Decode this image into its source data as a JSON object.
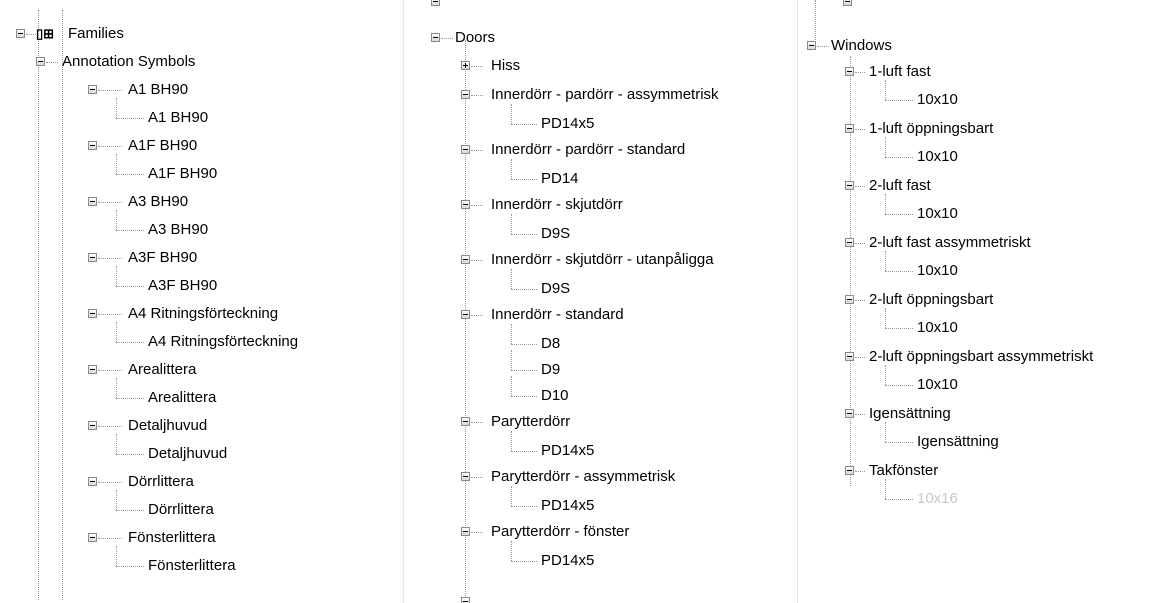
{
  "col1": {
    "root": "Families",
    "category": "Annotation Symbols",
    "items": [
      {
        "label": "A1 BH90",
        "child": "A1 BH90"
      },
      {
        "label": "A1F BH90",
        "child": "A1F BH90"
      },
      {
        "label": "A3 BH90",
        "child": "A3 BH90"
      },
      {
        "label": "A3F BH90",
        "child": "A3F BH90"
      },
      {
        "label": "A4 Ritningsförteckning",
        "child": "A4 Ritningsförteckning"
      },
      {
        "label": "Arealittera",
        "child": "Arealittera"
      },
      {
        "label": "Detaljhuvud",
        "child": "Detaljhuvud"
      },
      {
        "label": "Dörrlittera",
        "child": "Dörrlittera"
      },
      {
        "label": "Fönsterlittera",
        "child": "Fönsterlittera"
      }
    ]
  },
  "col2": {
    "category": "Doors",
    "items": [
      {
        "label": "Hiss",
        "children": []
      },
      {
        "label": "Innerdörr - pardörr - assymmetrisk",
        "children": [
          "PD14x5"
        ]
      },
      {
        "label": "Innerdörr - pardörr - standard",
        "children": [
          "PD14"
        ]
      },
      {
        "label": "Innerdörr - skjutdörr",
        "children": [
          "D9S"
        ]
      },
      {
        "label": "Innerdörr - skjutdörr - utanpåligga",
        "children": [
          "D9S"
        ]
      },
      {
        "label": "Innerdörr - standard",
        "children": [
          "D8",
          "D9",
          "D10"
        ]
      },
      {
        "label": "Parytterdörr",
        "children": [
          "PD14x5"
        ]
      },
      {
        "label": "Parytterdörr - assymmetrisk",
        "children": [
          "PD14x5"
        ]
      },
      {
        "label": "Parytterdörr - fönster",
        "children": [
          "PD14x5"
        ]
      }
    ]
  },
  "col3": {
    "category": "Windows",
    "items": [
      {
        "label": "1-luft fast",
        "child": "10x10"
      },
      {
        "label": "1-luft öppningsbart",
        "child": "10x10"
      },
      {
        "label": "2-luft fast",
        "child": "10x10"
      },
      {
        "label": "2-luft fast assymmetriskt",
        "child": "10x10"
      },
      {
        "label": "2-luft öppningsbart",
        "child": "10x10"
      },
      {
        "label": "2-luft öppningsbart assymmetriskt",
        "child": "10x10"
      },
      {
        "label": "Igensättning",
        "child": "Igensättning"
      },
      {
        "label": "Takfönster",
        "child": "10x16"
      }
    ]
  }
}
